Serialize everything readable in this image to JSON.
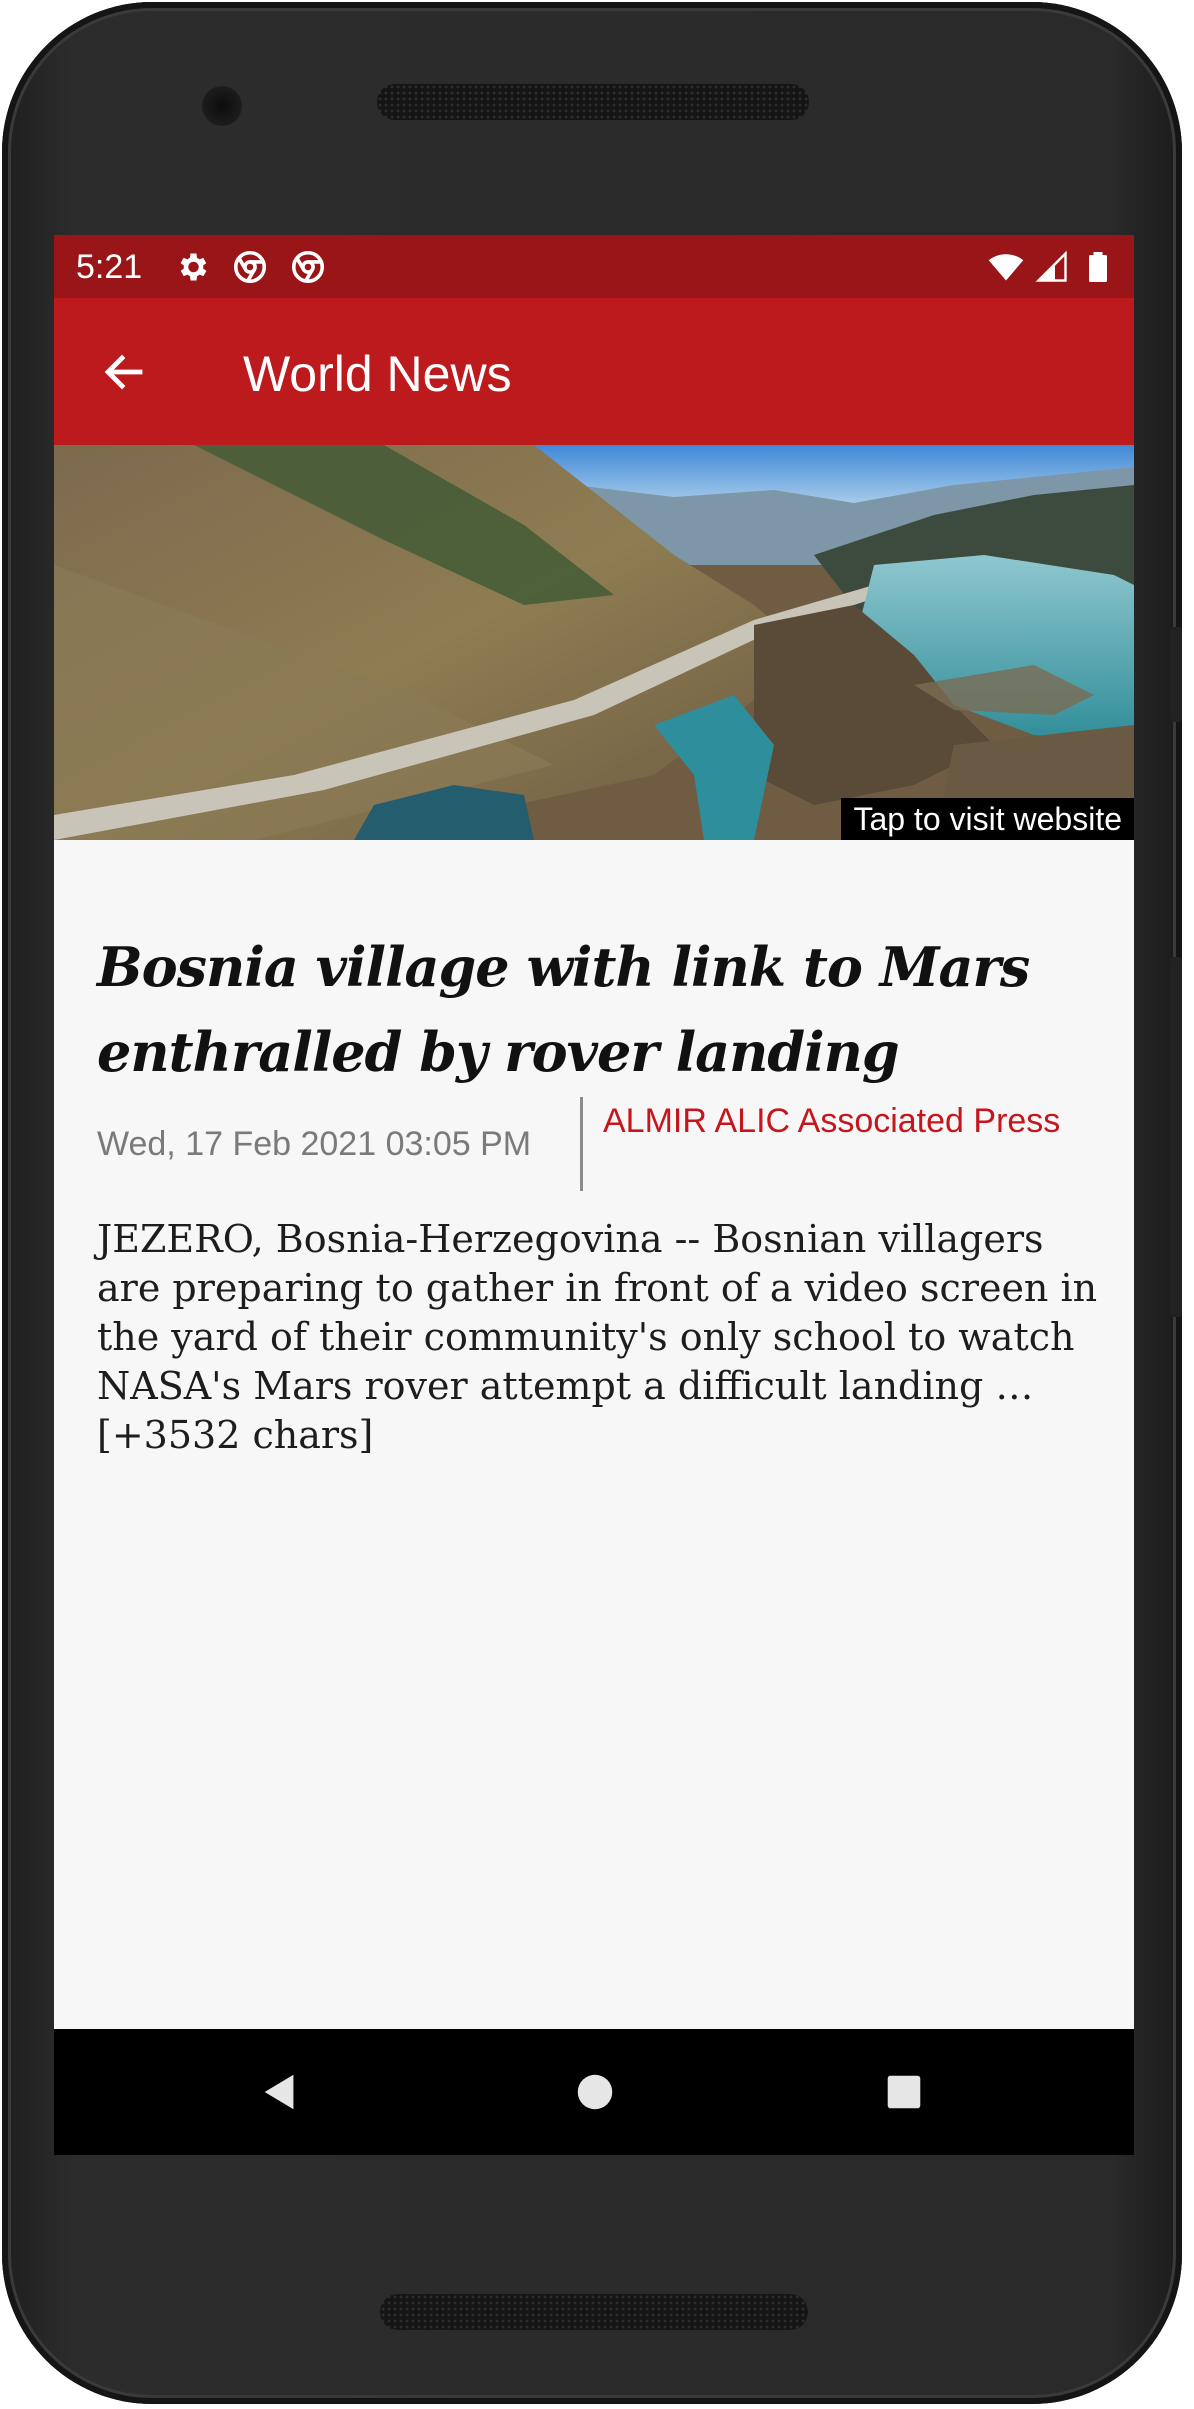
{
  "status_bar": {
    "time": "5:21",
    "left_icons": [
      "gear-icon",
      "chrome-icon",
      "chrome-icon"
    ],
    "right_icons": [
      "wifi-icon",
      "signal-icon",
      "battery-icon"
    ]
  },
  "app_bar": {
    "title": "World News",
    "back_icon": "arrow-left-icon"
  },
  "article": {
    "image_label": "Tap to visit website",
    "headline": "Bosnia village with link to Mars enthralled by rover landing",
    "date": "Wed, 17 Feb 2021 03:05 PM",
    "author": "ALMIR ALIC Associated Press",
    "body": "JEZERO, Bosnia-Herzegovina -- Bosnian villagers are preparing to gather in front of a video screen in the yard of their community's only school to watch NASA's Mars rover attempt a difficult landing … [+3532 chars]"
  },
  "nav_bar": {
    "icons": [
      "back-triangle-icon",
      "home-circle-icon",
      "recents-square-icon"
    ]
  },
  "colors": {
    "status_bar": "#9a1518",
    "app_bar": "#bd1a1d",
    "author_text": "#c4161c",
    "background": "#f7f7f7"
  }
}
